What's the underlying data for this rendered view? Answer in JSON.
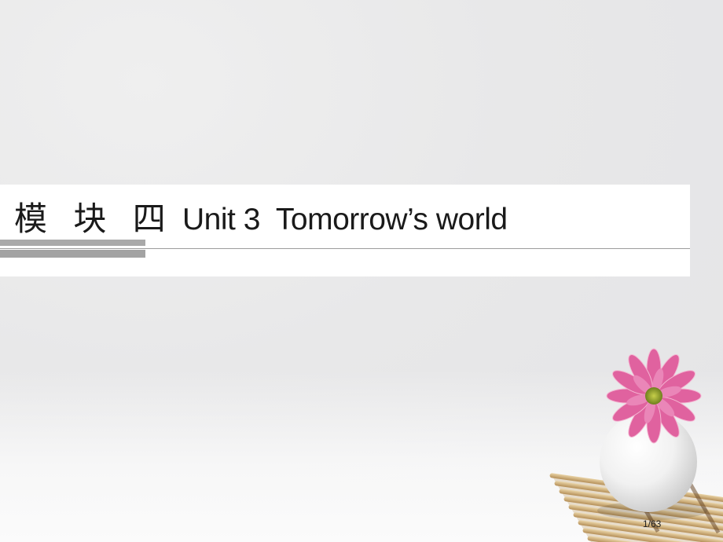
{
  "slide": {
    "module_label": "模 块 四",
    "unit_label": "Unit 3",
    "unit_topic": "Tomorrow’s world",
    "page_number": "1/63"
  },
  "decoration": {
    "flower_icon": "pink-daisy",
    "vase_icon": "white-round-vase",
    "mat_icon": "bamboo-mat",
    "petal_color": "#e0629f",
    "center_color": "#8a9b2a"
  }
}
